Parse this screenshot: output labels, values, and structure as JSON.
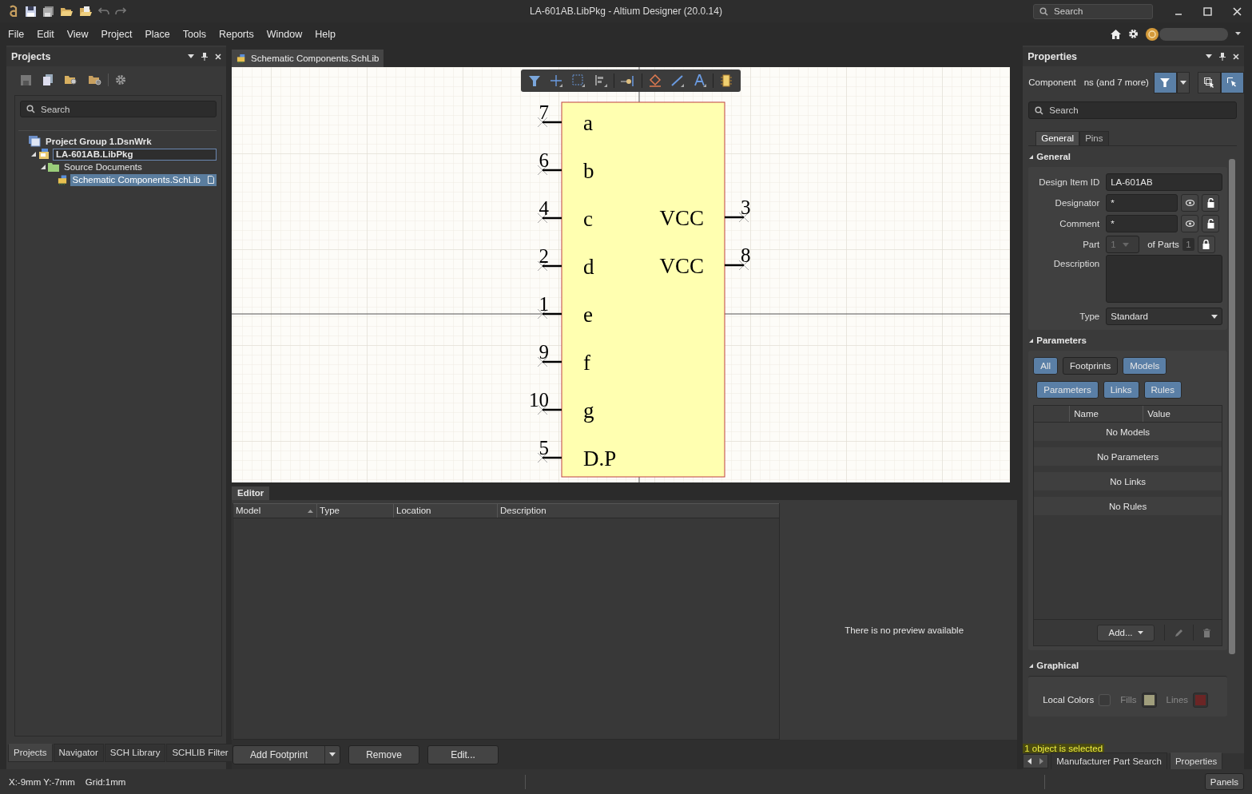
{
  "title_bar": {
    "title": "LA-601AB.LibPkg - Altium Designer (20.0.14)",
    "search_placeholder": "Search"
  },
  "menu": [
    "File",
    "Edit",
    "View",
    "Project",
    "Place",
    "Tools",
    "Reports",
    "Window",
    "Help"
  ],
  "projects_panel": {
    "title": "Projects",
    "search_placeholder": "Search",
    "tree": [
      {
        "label": "Project Group 1.DsnWrk",
        "kind": "group",
        "selected": false,
        "children": [
          {
            "label": "LA-601AB.LibPkg",
            "kind": "package",
            "selected": false,
            "focused": true,
            "expanded": true,
            "children": [
              {
                "label": "Source Documents",
                "kind": "folder",
                "selected": false,
                "expanded": true,
                "children": [
                  {
                    "label": "Schematic Components.SchLib",
                    "kind": "schlib",
                    "selected": true
                  }
                ]
              }
            ]
          }
        ]
      }
    ],
    "tabs": [
      {
        "label": "Projects",
        "selected": true
      },
      {
        "label": "Navigator",
        "selected": false
      },
      {
        "label": "SCH Library",
        "selected": false
      },
      {
        "label": "SCHLIB Filter",
        "selected": false
      }
    ]
  },
  "document_tab": {
    "label": "Schematic Components.SchLib",
    "selected": true
  },
  "component": {
    "left_pins": [
      {
        "number": "7",
        "name": "a"
      },
      {
        "number": "6",
        "name": "b"
      },
      {
        "number": "4",
        "name": "c"
      },
      {
        "number": "2",
        "name": "d"
      },
      {
        "number": "1",
        "name": "e"
      },
      {
        "number": "9",
        "name": "f"
      },
      {
        "number": "10",
        "name": "g"
      },
      {
        "number": "5",
        "name": "D.P"
      }
    ],
    "right_pins": [
      {
        "number": "3",
        "name": "VCC"
      },
      {
        "number": "8",
        "name": "VCC"
      }
    ]
  },
  "editor": {
    "tab": "Editor",
    "columns": [
      "Model",
      "Type",
      "Location",
      "Description"
    ],
    "preview_text": "There is no preview available",
    "buttons": [
      {
        "label": "Add Footprint",
        "kind": "split"
      },
      {
        "label": "Remove",
        "kind": "plain"
      },
      {
        "label": "Edit...",
        "kind": "plain"
      }
    ]
  },
  "properties": {
    "title": "Properties",
    "filter_label": "Component",
    "filter_text": "ns (and 7 more)",
    "search_placeholder": "Search",
    "tabs": [
      {
        "label": "General",
        "selected": true
      },
      {
        "label": "Pins",
        "selected": false
      }
    ],
    "general": {
      "title": "General",
      "expanded": true,
      "fields": [
        {
          "label": "Design Item ID",
          "kind": "text",
          "value": "LA-601AB"
        },
        {
          "label": "Designator",
          "kind": "locked",
          "value": "*"
        },
        {
          "label": "Comment",
          "kind": "locked",
          "value": "*"
        },
        {
          "label": "Part",
          "kind": "part",
          "value": "1",
          "of_label": "of Parts",
          "count": "1",
          "disabled": true
        },
        {
          "label": "Description",
          "kind": "textarea"
        },
        {
          "label": "Type",
          "kind": "dropdown",
          "value": "Standard"
        }
      ]
    },
    "parameters": {
      "title": "Parameters",
      "expanded": true,
      "filters": [
        {
          "label": "All",
          "selected": true
        },
        {
          "label": "Footprints",
          "selected": false
        },
        {
          "label": "Models",
          "selected": true
        },
        {
          "label": "Parameters",
          "selected": true
        },
        {
          "label": "Links",
          "selected": true
        },
        {
          "label": "Rules",
          "selected": true
        }
      ],
      "columns": [
        "Name",
        "Value"
      ],
      "rows": [
        "No Models",
        "No Parameters",
        "No Links",
        "No Rules"
      ],
      "add_button": "Add..."
    },
    "graphical": {
      "title": "Graphical",
      "expanded": true,
      "local_colors_label": "Local Colors",
      "local_colors_checked": false,
      "swatches": [
        {
          "label": "Fills",
          "color": "#a09e7c"
        },
        {
          "label": "Lines",
          "color": "#6b2525"
        }
      ]
    },
    "status_message": "1 object is selected",
    "bottom_tabs": [
      {
        "label": "Manufacturer Part Search",
        "selected": false
      },
      {
        "label": "Properties",
        "selected": true
      }
    ]
  },
  "status_bar": {
    "coordinates": "X:-9mm Y:-7mm",
    "grid": "Grid:1mm",
    "panels_button": "Panels"
  }
}
